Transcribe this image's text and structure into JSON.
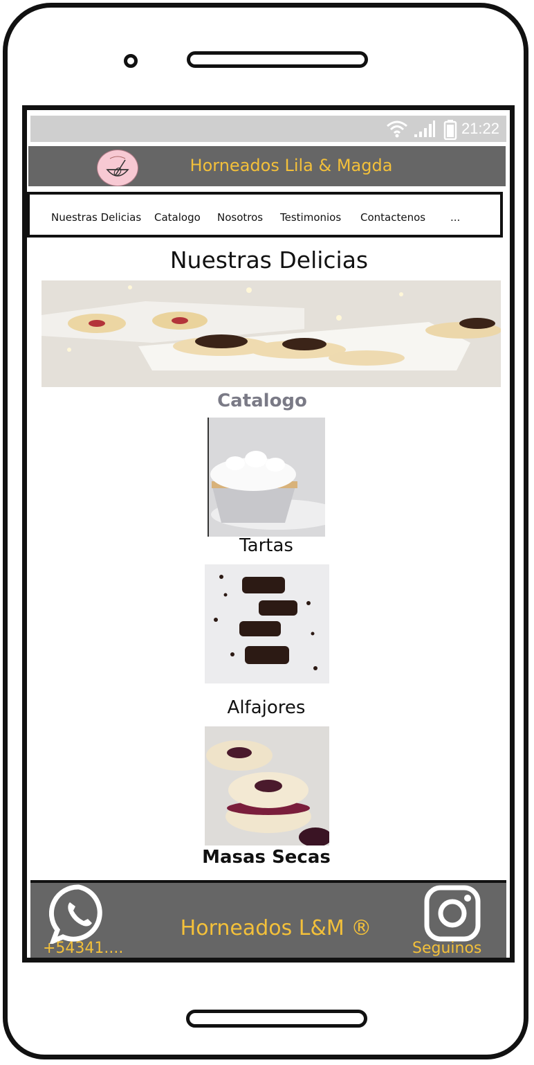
{
  "status_bar": {
    "time": "21:22"
  },
  "header": {
    "title": "Horneados Lila & Magda"
  },
  "nav": {
    "items": [
      "Nuestras Delicias",
      "Catalogo",
      "Nosotros",
      "Testimonios",
      "Contactenos",
      "..."
    ]
  },
  "main": {
    "title": "Nuestras Delicias",
    "catalog_heading": "Catalogo",
    "products": [
      {
        "label": "Tartas"
      },
      {
        "label": "Alfajores"
      },
      {
        "label": "Masas Secas"
      }
    ]
  },
  "footer": {
    "brand": "Horneados L&M ®",
    "phone": "+54341....",
    "follow": "Seguinos",
    "icons": [
      "whatsapp-icon",
      "instagram-icon"
    ]
  },
  "colors": {
    "accent": "#f3c03a",
    "bar": "#666666",
    "catalog_heading": "#7a7a86"
  }
}
